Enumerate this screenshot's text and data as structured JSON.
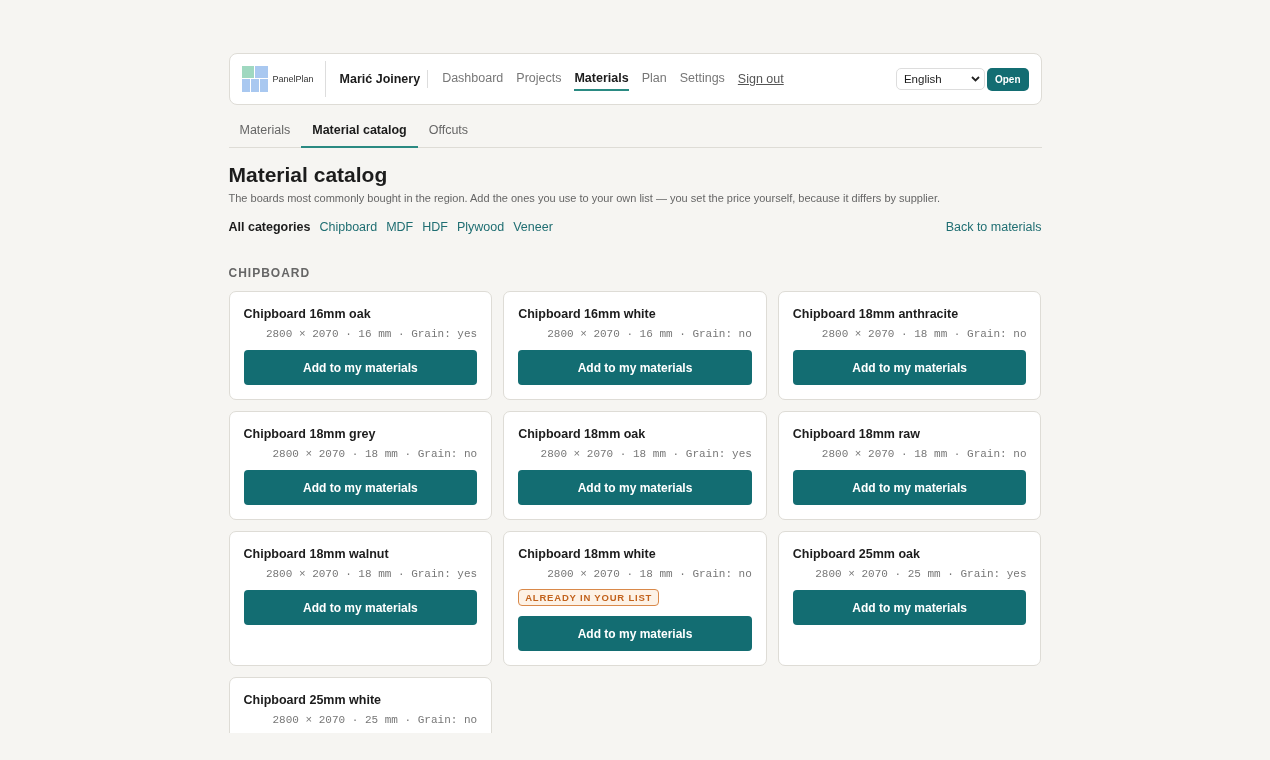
{
  "header": {
    "logo_text": "PanelPlan",
    "workshop": "Marić Joinery",
    "nav": [
      {
        "label": "Dashboard",
        "selected": false
      },
      {
        "label": "Projects",
        "selected": false
      },
      {
        "label": "Materials",
        "selected": true
      },
      {
        "label": "Plan",
        "selected": false
      },
      {
        "label": "Settings",
        "selected": false
      }
    ],
    "sign_out": "Sign out",
    "language": "English",
    "open_button": "Open"
  },
  "subtabs": [
    {
      "label": "Materials",
      "selected": false
    },
    {
      "label": "Material catalog",
      "selected": true
    },
    {
      "label": "Offcuts",
      "selected": false
    }
  ],
  "title": "Material catalog",
  "description": "The boards most commonly bought in the region. Add the ones you use to your own list — you set the price yourself, because it differs by supplier.",
  "filters": [
    {
      "label": "All categories",
      "selected": true
    },
    {
      "label": "Chipboard",
      "selected": false
    },
    {
      "label": "MDF",
      "selected": false
    },
    {
      "label": "HDF",
      "selected": false
    },
    {
      "label": "Plywood",
      "selected": false
    },
    {
      "label": "Veneer",
      "selected": false
    }
  ],
  "back_link": "Back to materials",
  "section": "CHIPBOARD",
  "cards": [
    {
      "name": "Chipboard 16mm oak",
      "spec": "2800 × 2070 · 16 mm · Grain: yes",
      "in_list": false,
      "button": "Add to my materials"
    },
    {
      "name": "Chipboard 16mm white",
      "spec": "2800 × 2070 · 16 mm · Grain: no",
      "in_list": false,
      "button": "Add to my materials"
    },
    {
      "name": "Chipboard 18mm anthracite",
      "spec": "2800 × 2070 · 18 mm · Grain: no",
      "in_list": false,
      "button": "Add to my materials"
    },
    {
      "name": "Chipboard 18mm grey",
      "spec": "2800 × 2070 · 18 mm · Grain: no",
      "in_list": false,
      "button": "Add to my materials"
    },
    {
      "name": "Chipboard 18mm oak",
      "spec": "2800 × 2070 · 18 mm · Grain: yes",
      "in_list": false,
      "button": "Add to my materials"
    },
    {
      "name": "Chipboard 18mm raw",
      "spec": "2800 × 2070 · 18 mm · Grain: no",
      "in_list": false,
      "button": "Add to my materials"
    },
    {
      "name": "Chipboard 18mm walnut",
      "spec": "2800 × 2070 · 18 mm · Grain: yes",
      "in_list": false,
      "button": "Add to my materials"
    },
    {
      "name": "Chipboard 18mm white",
      "spec": "2800 × 2070 · 18 mm · Grain: no",
      "in_list": true,
      "badge": "ALREADY IN YOUR LIST",
      "button": "Add to my materials"
    },
    {
      "name": "Chipboard 25mm oak",
      "spec": "2800 × 2070 · 25 mm · Grain: yes",
      "in_list": false,
      "button": "Add to my materials"
    },
    {
      "name": "Chipboard 25mm white",
      "spec": "2800 × 2070 · 25 mm · Grain: no",
      "in_list": false
    }
  ]
}
